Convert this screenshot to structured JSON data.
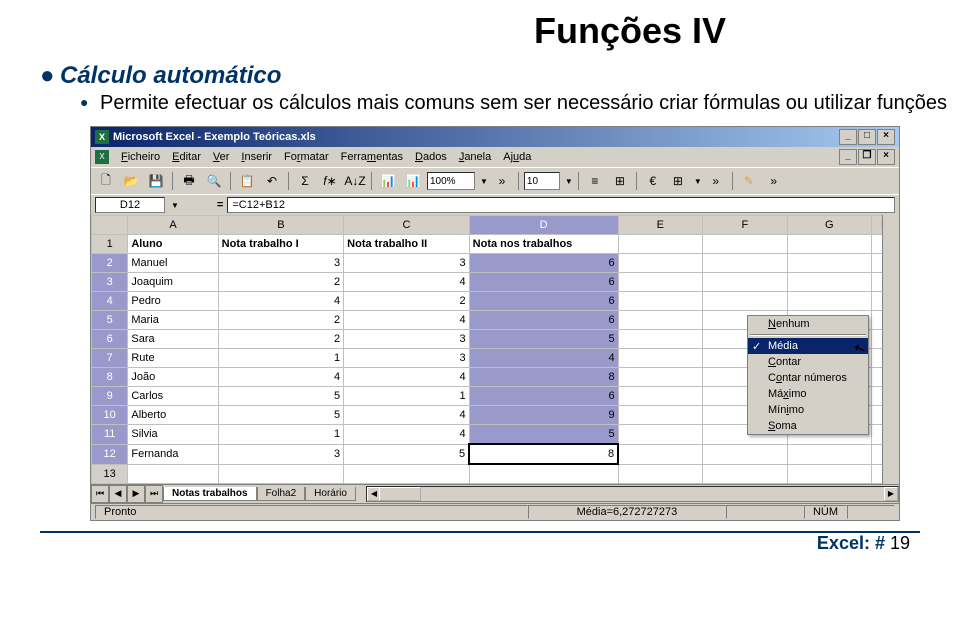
{
  "slide": {
    "title": "Funções IV",
    "bullet1": "Cálculo automático",
    "bullet2": "Permite efectuar os cálculos mais comuns sem ser necessário criar fórmulas ou utilizar funções"
  },
  "window": {
    "title": "Microsoft Excel - Exemplo Teóricas.xls"
  },
  "menu": {
    "ficheiro": "Ficheiro",
    "editar": "Editar",
    "ver": "Ver",
    "inserir": "Inserir",
    "formatar": "Formatar",
    "ferramentas": "Ferramentas",
    "dados": "Dados",
    "janela": "Janela",
    "ajuda": "Ajuda"
  },
  "toolbar": {
    "zoom": "100%",
    "fontsize": "10"
  },
  "formula": {
    "cell_ref": "D12",
    "formula": "=C12+B12",
    "eq": "="
  },
  "columns": [
    "A",
    "B",
    "C",
    "D",
    "E",
    "F",
    "G"
  ],
  "headers": {
    "a": "Aluno",
    "b": "Nota trabalho I",
    "c": "Nota trabalho II",
    "d": "Nota nos trabalhos"
  },
  "rows": [
    {
      "n": "1"
    },
    {
      "n": "2",
      "a": "Manuel",
      "b": "3",
      "c": "3",
      "d": "6"
    },
    {
      "n": "3",
      "a": "Joaquim",
      "b": "2",
      "c": "4",
      "d": "6"
    },
    {
      "n": "4",
      "a": "Pedro",
      "b": "4",
      "c": "2",
      "d": "6"
    },
    {
      "n": "5",
      "a": "Maria",
      "b": "2",
      "c": "4",
      "d": "6"
    },
    {
      "n": "6",
      "a": "Sara",
      "b": "2",
      "c": "3",
      "d": "5"
    },
    {
      "n": "7",
      "a": "Rute",
      "b": "1",
      "c": "3",
      "d": "4"
    },
    {
      "n": "8",
      "a": "João",
      "b": "4",
      "c": "4",
      "d": "8"
    },
    {
      "n": "9",
      "a": "Carlos",
      "b": "5",
      "c": "1",
      "d": "6"
    },
    {
      "n": "10",
      "a": "Alberto",
      "b": "5",
      "c": "4",
      "d": "9"
    },
    {
      "n": "11",
      "a": "Silvia",
      "b": "1",
      "c": "4",
      "d": "5"
    },
    {
      "n": "12",
      "a": "Fernanda",
      "b": "3",
      "c": "5",
      "d": "8"
    },
    {
      "n": "13"
    }
  ],
  "context_menu": {
    "nenhum": "Nenhum",
    "media": "Média",
    "contar": "Contar",
    "contar_numeros": "Contar números",
    "maximo": "Máximo",
    "minimo": "Mínimo",
    "soma": "Soma"
  },
  "tabs": {
    "t1": "Notas trabalhos",
    "t2": "Folha2",
    "t3": "Horário"
  },
  "status": {
    "ready": "Pronto",
    "calc": "Média=6,272727273",
    "num": "NÚM"
  },
  "footer": {
    "label": "Excel: # ",
    "num": "19"
  }
}
